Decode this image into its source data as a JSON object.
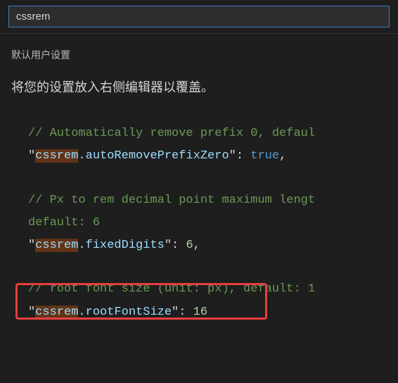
{
  "search": {
    "value": "cssrem"
  },
  "section": {
    "title": "默认用户设置"
  },
  "description": "将您的设置放入右侧编辑器以覆盖。",
  "code": {
    "s1": {
      "comment": "// Automatically remove prefix 0, defaul",
      "key_prefix_hl": "cssrem",
      "key_rest": ".autoRemovePrefixZero",
      "value": "true"
    },
    "s2": {
      "comment1": "// Px to rem decimal point maximum lengt",
      "comment2": "default: 6",
      "key_prefix_hl": "cssrem",
      "key_rest": ".fixedDigits",
      "value": "6"
    },
    "s3": {
      "comment": "// root font size (unit: px), default: 1",
      "key_prefix_hl": "cssrem",
      "key_rest": ".rootFontSize",
      "value": "16"
    }
  }
}
